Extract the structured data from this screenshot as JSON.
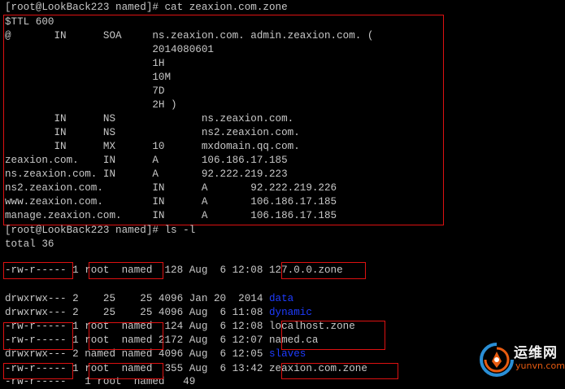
{
  "commands": {
    "cat": "[root@LookBack223 named]# cat zeaxion.com.zone",
    "ls": "[root@LookBack223 named]# ls -l"
  },
  "zone_lines": [
    "$TTL 600",
    "@       IN      SOA     ns.zeaxion.com. admin.zeaxion.com. (",
    "                        2014080601",
    "                        1H",
    "                        10M",
    "                        7D",
    "                        2H )",
    "        IN      NS              ns.zeaxion.com.",
    "        IN      NS              ns2.zeaxion.com.",
    "        IN      MX      10      mxdomain.qq.com.",
    "zeaxion.com.    IN      A       106.186.17.185",
    "ns.zeaxion.com. IN      A       92.222.219.223",
    "ns2.zeaxion.com.        IN      A       92.222.219.226",
    "www.zeaxion.com.        IN      A       106.186.17.185",
    "manage.zeaxion.com.     IN      A       106.186.17.185"
  ],
  "total": "total 36",
  "files": [
    {
      "prefix": "-rw-r----- 1 root  named  128 Aug  6 12:08 ",
      "name": "127.0.0.zone",
      "dir": false
    },
    {
      "prefix": "drwxrwx--- 2    25    25 4096 Jan 20  2014 ",
      "name": "data",
      "dir": true
    },
    {
      "prefix": "drwxrwx--- 2    25    25 4096 Aug  6 11:08 ",
      "name": "dynamic",
      "dir": true
    },
    {
      "prefix": "-rw-r----- 1 root  named  124 Aug  6 12:08 ",
      "name": "localhost.zone",
      "dir": false
    },
    {
      "prefix": "-rw-r----- 1 root  named 2172 Aug  6 12:07 ",
      "name": "named.ca",
      "dir": false
    },
    {
      "prefix": "drwxrwx--- 2 named named 4096 Aug  6 12:05 ",
      "name": "slaves",
      "dir": true
    },
    {
      "prefix": "-rw-r----- 1 root  named  355 Aug  6 13:42 ",
      "name": "zeaxion.com.zone",
      "dir": false
    }
  ],
  "partial_line": "-rw-r-----   1 root  named   49",
  "watermark": {
    "title": "运维网",
    "url": "yunvn.com"
  },
  "colors": {
    "background": "#000000",
    "text": "#c8c8c8",
    "directory": "#1e3cff",
    "highlight": "#dd1111",
    "watermark_accent": "#e85b10"
  }
}
